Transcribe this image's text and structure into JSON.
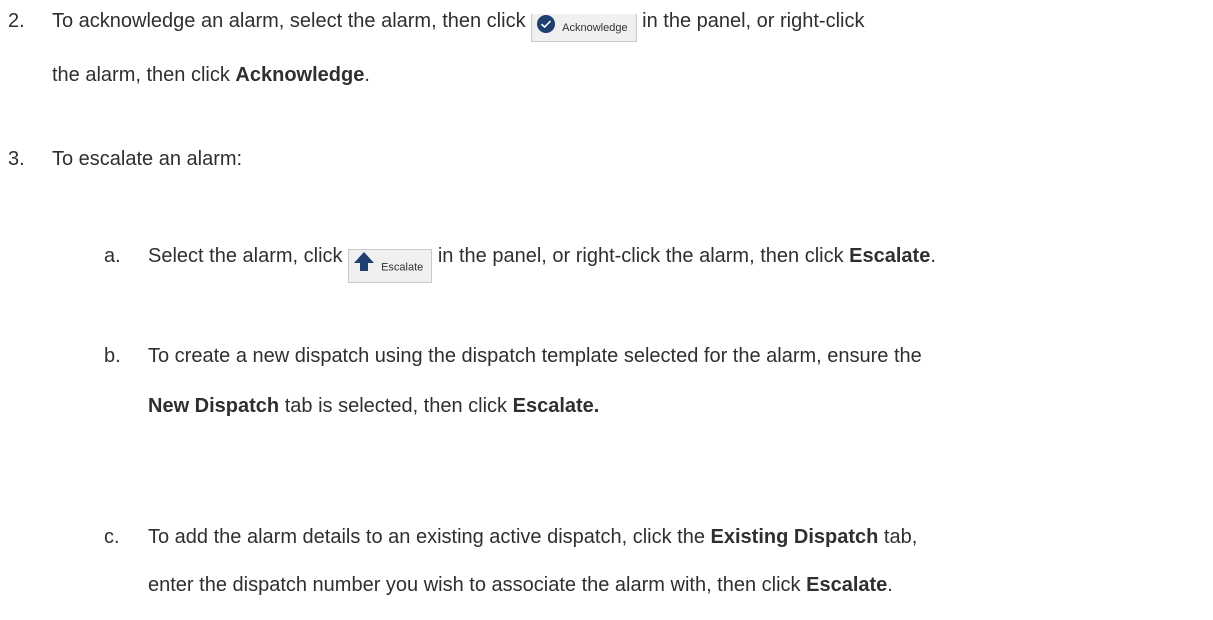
{
  "step2": {
    "number": "2.",
    "line1_before": "To acknowledge an alarm, select the alarm, then click",
    "button_label": "Acknowledge",
    "line1_after": "in the panel, or right-click",
    "line2_before": "the alarm, then click",
    "line2_bold": "Acknowledge",
    "line2_after": "."
  },
  "step3": {
    "number": "3.",
    "text": "To escalate an alarm:",
    "sub_a": {
      "letter": "a.",
      "before": "Select the alarm, click",
      "button_label": "Escalate",
      "after": "in the panel, or right-click the alarm, then click",
      "bold": "Escalate",
      "end": "."
    },
    "sub_b": {
      "letter": "b.",
      "line1": "To create a new dispatch using the dispatch template selected for the alarm, ensure the",
      "bold1": "New Dispatch",
      "mid": "tab is selected, then click",
      "bold2": "Escalate."
    },
    "sub_c": {
      "letter": "c.",
      "line1_before": "To add the alarm details to an existing active dispatch, click the",
      "bold1": "Existing Dispatch",
      "line1_after": "tab,",
      "line2_before": "enter the dispatch number you wish to associate the alarm with, then click",
      "bold2": "Escalate",
      "line2_after": "."
    }
  },
  "colors": {
    "text": "#2f2f2f",
    "button_bg": "#f0f0f0",
    "ack_icon": "#1f3f6e",
    "escalate_icon": "#1f3f6e"
  }
}
